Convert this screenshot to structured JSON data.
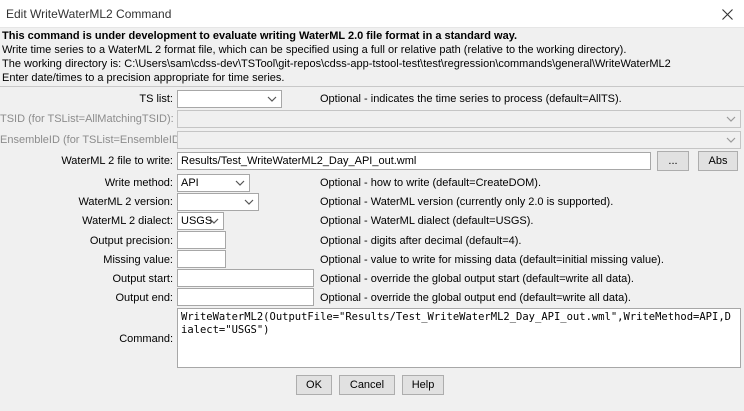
{
  "window": {
    "title": "Edit WriteWaterML2 Command",
    "close_icon": "close-icon"
  },
  "info": {
    "warning": "This command is under development to evaluate writing WaterML 2.0 file format in a standard way.",
    "line1": "Write time series to a WaterML 2 format file, which can be specified using a full or relative path (relative to the working directory).",
    "line2": "The working directory is: C:\\Users\\sam\\cdss-dev\\TSTool\\git-repos\\cdss-app-tstool-test\\test\\regression\\commands\\general\\WriteWaterML2",
    "line3": "Enter date/times to a precision appropriate for time series."
  },
  "form": {
    "ts_list": {
      "label": "TS list:",
      "value": "",
      "desc": "Optional - indicates the time series to process (default=AllTS)."
    },
    "tsid": {
      "label": "TSID (for TSList=AllMatchingTSID):",
      "value": ""
    },
    "ensemble": {
      "label": "EnsembleID (for TSList=EnsembleID):",
      "value": ""
    },
    "output_file": {
      "label": "WaterML 2 file to write:",
      "value": "Results/Test_WriteWaterML2_Day_API_out.wml",
      "browse": "...",
      "abs": "Abs"
    },
    "write_method": {
      "label": "Write method:",
      "value": "API",
      "desc": "Optional - how to write (default=CreateDOM)."
    },
    "version": {
      "label": "WaterML 2 version:",
      "value": "",
      "desc": "Optional - WaterML version (currently only 2.0 is supported)."
    },
    "dialect": {
      "label": "WaterML 2 dialect:",
      "value": "USGS",
      "desc": "Optional - WaterML dialect (default=USGS)."
    },
    "precision": {
      "label": "Output precision:",
      "value": "",
      "desc": "Optional - digits after decimal (default=4)."
    },
    "missing": {
      "label": "Missing value:",
      "value": "",
      "desc": "Optional - value to write for missing data (default=initial missing value)."
    },
    "start": {
      "label": "Output start:",
      "value": "",
      "desc": "Optional - override the global output start (default=write all data)."
    },
    "end": {
      "label": "Output end:",
      "value": "",
      "desc": "Optional - override the global output end (default=write all data)."
    },
    "command": {
      "label": "Command:",
      "value": "WriteWaterML2(OutputFile=\"Results/Test_WriteWaterML2_Day_API_out.wml\",WriteMethod=API,Dialect=\"USGS\")"
    }
  },
  "buttons": {
    "ok": "OK",
    "cancel": "Cancel",
    "help": "Help"
  }
}
